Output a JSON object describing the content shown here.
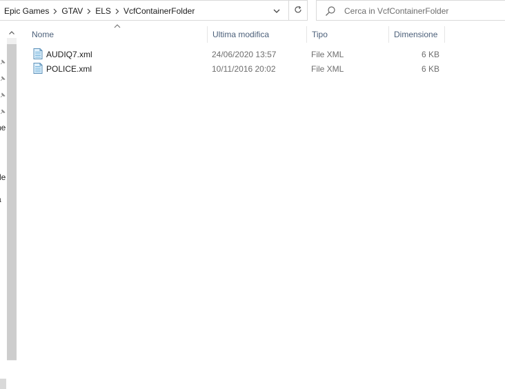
{
  "breadcrumb": [
    "Epic Games",
    "GTAV",
    "ELS",
    "VcfContainerFolder"
  ],
  "search": {
    "placeholder": "Cerca in VcfContainerFolder"
  },
  "columns": {
    "name": "Nome",
    "modified": "Ultima modifica",
    "type": "Tipo",
    "size": "Dimensione"
  },
  "files": [
    {
      "name": "AUDIQ7.xml",
      "modified": "24/06/2020 13:57",
      "type": "File XML",
      "size": "6 KB",
      "icon": "xml-file-icon"
    },
    {
      "name": "POLICE.xml",
      "modified": "10/11/2016 20:02",
      "type": "File XML",
      "size": "6 KB",
      "icon": "xml-file-icon"
    }
  ],
  "nav_fragments": [
    "ne",
    "de",
    "a"
  ],
  "icons": [
    "chevron-right-icon",
    "chevron-down-icon",
    "refresh-icon",
    "search-icon",
    "pin-icon",
    "sort-ascending-icon",
    "xml-file-icon"
  ],
  "colors": {
    "header_text": "#4c607a",
    "secondary_text": "#6d6d6d",
    "border": "#d9d9d9",
    "file_icon": "#6fb0d9"
  }
}
